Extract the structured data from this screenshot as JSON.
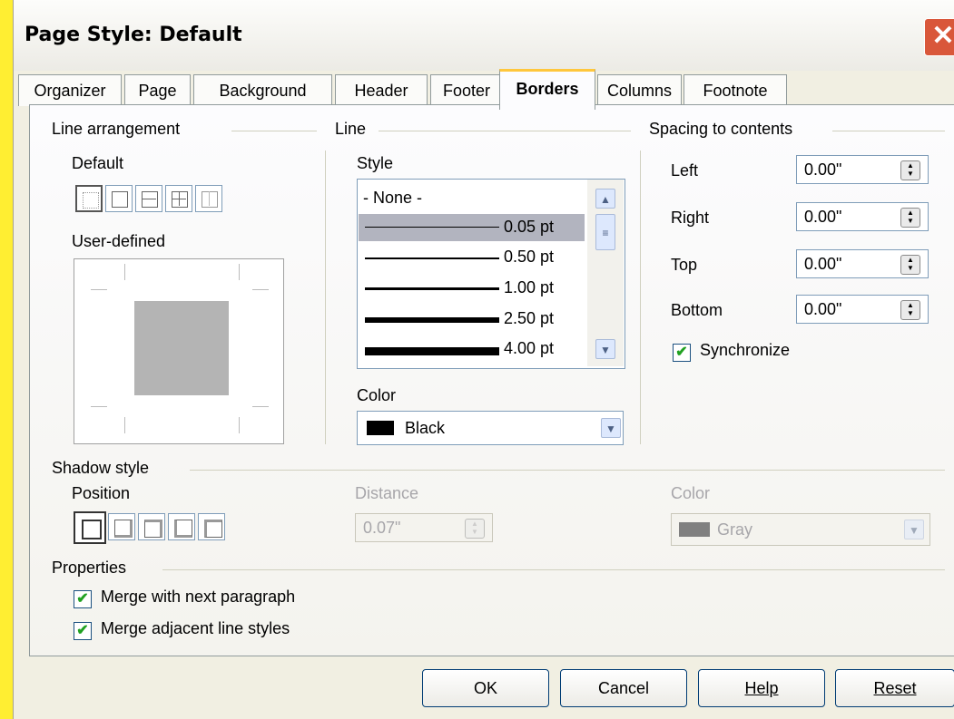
{
  "window": {
    "title": "Page Style: Default",
    "close": "✕"
  },
  "tabs": [
    "Organizer",
    "Page",
    "Background",
    "Header",
    "Footer",
    "Borders",
    "Columns",
    "Footnote"
  ],
  "line_arrangement": {
    "heading": "Line arrangement",
    "default_label": "Default",
    "user_defined_label": "User-defined"
  },
  "line": {
    "heading": "Line",
    "style_label": "Style",
    "styles": [
      "- None -",
      "0.05 pt",
      "0.50 pt",
      "1.00 pt",
      "2.50 pt",
      "4.00 pt"
    ],
    "selected_style": "0.05 pt",
    "color_label": "Color",
    "color_value": "Black",
    "color_hex": "#000000"
  },
  "spacing": {
    "heading": "Spacing to contents",
    "left_label": "Left",
    "left_value": "0.00\"",
    "right_label": "Right",
    "right_value": "0.00\"",
    "top_label": "Top",
    "top_value": "0.00\"",
    "bottom_label": "Bottom",
    "bottom_value": "0.00\"",
    "synchronize_label": "Synchronize",
    "synchronize_checked": true
  },
  "shadow": {
    "heading": "Shadow style",
    "position_label": "Position",
    "distance_label": "Distance",
    "distance_value": "0.07\"",
    "color_label": "Color",
    "color_value": "Gray",
    "color_hex": "#808080"
  },
  "properties": {
    "heading": "Properties",
    "merge_next_label": "Merge with next paragraph",
    "merge_next_checked": true,
    "merge_adjacent_label": "Merge adjacent line styles",
    "merge_adjacent_checked": true
  },
  "buttons": {
    "ok": "OK",
    "cancel": "Cancel",
    "help": "Help",
    "reset": "Reset"
  },
  "icons": {
    "check": "✔",
    "up": "▲",
    "down": "▼",
    "spin_up": "▲",
    "spin_down": "▼"
  }
}
